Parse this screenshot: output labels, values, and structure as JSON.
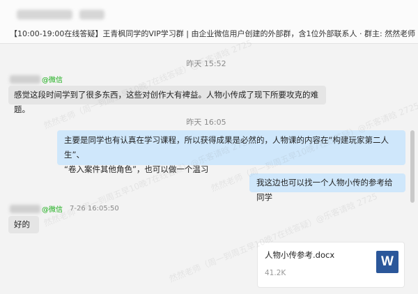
{
  "header": {
    "group_description": "【10:00-19:00在线答疑】王青枫同学的VIP学习群 | 由企业微信用户创建的外部群，含1位外部联系人 · 群主: 然然老师（周一到周五"
  },
  "messages": {
    "m1_time": "昨天 15:52",
    "m1_source": "@微信",
    "m1_text": "感觉这段时间学到了很多东西，这些对创作大有裨益。人物小传成了现下所要攻克的难题。",
    "m2_time": "昨天 16:05",
    "m2_line1": "主要是同学也有认真在学习课程，所以获得成果是必然的，人物课的内容在“构建玩家第二人生”、",
    "m2_line2": "“卷入案件其他角色”，也可以做一个温习",
    "m3_text": "我这边也可以找一个人物小传的参考给同学",
    "m4_source": "@微信",
    "m4_time": "7-26 16:05:50",
    "m4_text": "好的",
    "file_name": "人物小传参考.docx",
    "file_size": "41.2K",
    "file_icon": "word-file-icon",
    "file_icon_letter": "W"
  },
  "watermark": {
    "text": "然然老师（周一到周五早10晚7在线答疑）@乐客请晗 2725"
  },
  "colors": {
    "incoming_bubble": "#e5e5e5",
    "outgoing_bubble": "#cfe7fb",
    "wechat_green": "#1aad19",
    "word_blue": "#2b579a"
  }
}
